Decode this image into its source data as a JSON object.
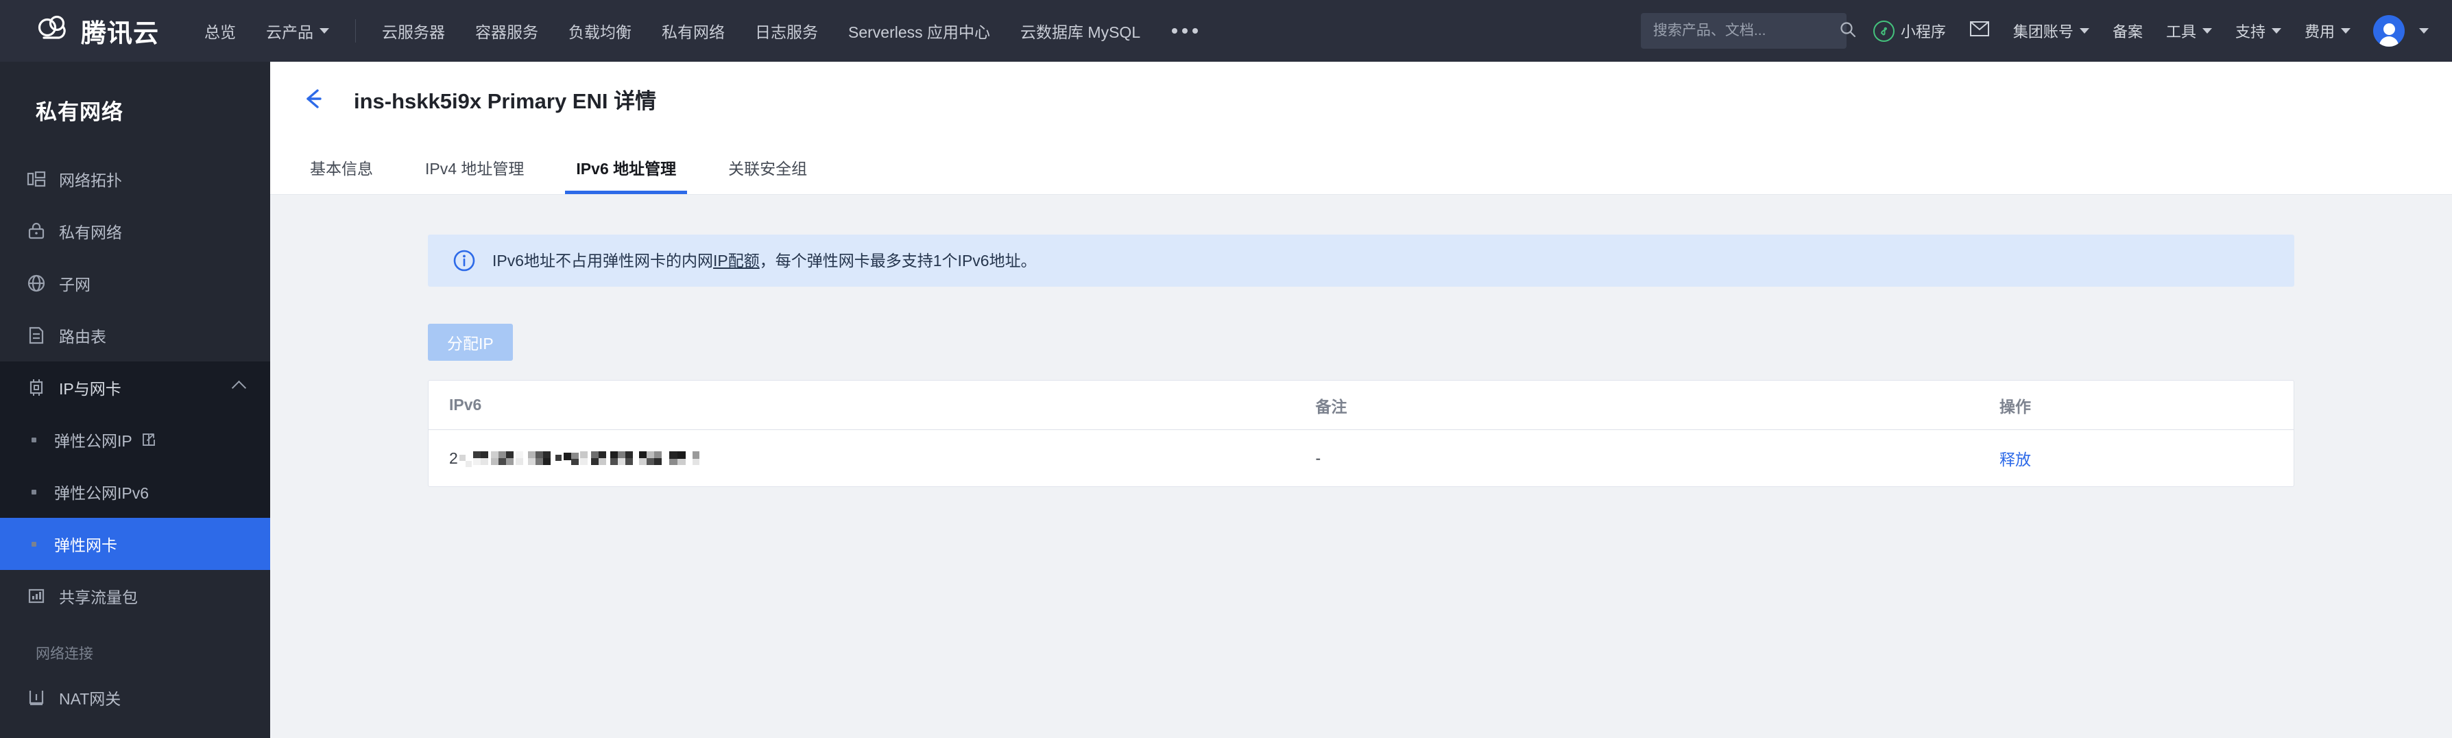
{
  "header": {
    "brand": "腾讯云",
    "brand_icon": "tencent-cloud-logo",
    "nav_primary": [
      {
        "label": "总览",
        "has_caret": false
      },
      {
        "label": "云产品",
        "has_caret": true
      }
    ],
    "nav_secondary": [
      {
        "label": "云服务器"
      },
      {
        "label": "容器服务"
      },
      {
        "label": "负载均衡"
      },
      {
        "label": "私有网络"
      },
      {
        "label": "日志服务"
      },
      {
        "label": "Serverless 应用中心"
      },
      {
        "label": "云数据库 MySQL"
      }
    ],
    "more_icon": "ellipsis-icon",
    "search": {
      "placeholder": "搜索产品、文档...",
      "value": "",
      "icon": "search-icon"
    },
    "right_items": [
      {
        "label": "小程序",
        "icon": "mini-program-icon",
        "has_caret": false
      },
      {
        "label": "",
        "icon": "mail-icon",
        "has_caret": false
      },
      {
        "label": "集团账号",
        "icon": "",
        "has_caret": true
      },
      {
        "label": "备案",
        "icon": "",
        "has_caret": false
      },
      {
        "label": "工具",
        "icon": "",
        "has_caret": true
      },
      {
        "label": "支持",
        "icon": "",
        "has_caret": true
      },
      {
        "label": "费用",
        "icon": "",
        "has_caret": true
      }
    ],
    "avatar_icon": "user-avatar",
    "avatar_caret": true
  },
  "sidebar": {
    "title": "私有网络",
    "items": [
      {
        "label": "网络拓扑",
        "icon": "topology-icon"
      },
      {
        "label": "私有网络",
        "icon": "lock-icon"
      },
      {
        "label": "子网",
        "icon": "globe-icon"
      },
      {
        "label": "路由表",
        "icon": "document-icon"
      }
    ],
    "group": {
      "label": "IP与网卡",
      "icon": "chip-icon",
      "expanded": true,
      "chevron_icon": "chevron-up-icon",
      "children": [
        {
          "label": "弹性公网IP",
          "external": true,
          "external_icon": "external-link-icon",
          "active": false
        },
        {
          "label": "弹性公网IPv6",
          "external": false,
          "active": false
        },
        {
          "label": "弹性网卡",
          "external": false,
          "active": true
        }
      ]
    },
    "items_after": [
      {
        "label": "共享流量包",
        "icon": "chart-box-icon"
      }
    ],
    "section_label": "网络连接",
    "items_tail": [
      {
        "label": "NAT网关",
        "icon": "gateway-icon"
      }
    ]
  },
  "page": {
    "back_icon": "back-arrow-icon",
    "title": "ins-hskk5i9x Primary ENI 详情",
    "tabs": [
      {
        "label": "基本信息",
        "active": false
      },
      {
        "label": "IPv4 地址管理",
        "active": false
      },
      {
        "label": "IPv6 地址管理",
        "active": true
      },
      {
        "label": "关联安全组",
        "active": false
      }
    ],
    "notice": {
      "icon": "info-circle-icon",
      "text_before": "IPv6地址不占用弹性网卡的内网",
      "link_text": "IP配额",
      "text_after": "，每个弹性网卡最多支持1个IPv6地址。"
    },
    "allocate_button": {
      "label": "分配IP",
      "disabled": true
    },
    "table": {
      "columns": [
        "IPv6",
        "备注",
        "操作"
      ],
      "rows": [
        {
          "ipv6_visible_prefix": "2",
          "ipv6_redacted": true,
          "note": "-",
          "action": "释放"
        }
      ]
    }
  },
  "colors": {
    "header_bg": "#2b2f3c",
    "sidebar_bg": "#242832",
    "sidebar_group_bg": "#171b24",
    "accent_blue": "#2d6ae8",
    "content_bg": "#f0f2f5",
    "notice_bg": "#dbe8fb",
    "button_disabled": "#a8c8f5",
    "mini_program_green": "#44c17c"
  }
}
